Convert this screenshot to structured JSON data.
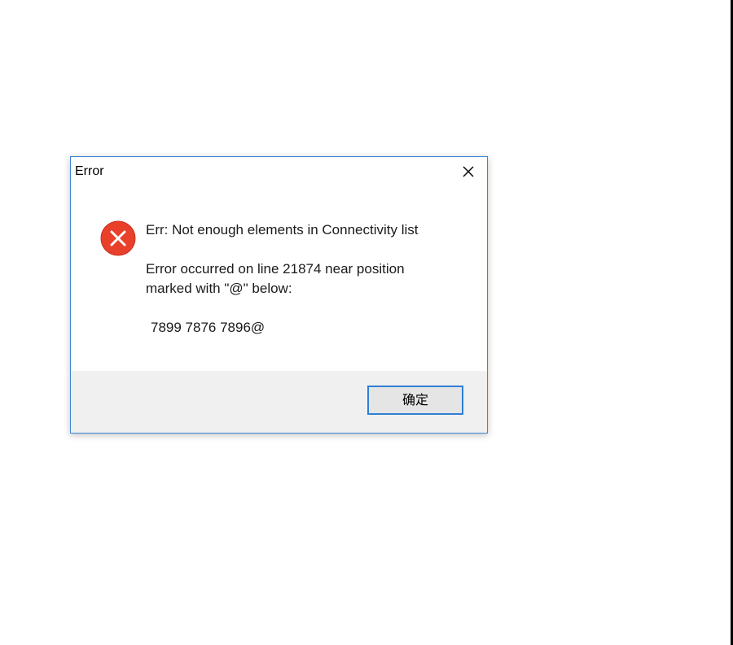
{
  "dialog": {
    "title": "Error",
    "close_icon": "close-icon",
    "icon": "error-x-icon",
    "icon_color": "#e8402b",
    "messages": [
      "Err:  Not enough elements in Connectivity list",
      "Error occurred on line 21874 near position",
      "marked with \"@\" below:",
      "7899 7876 7896@"
    ],
    "ok_label": "确定"
  },
  "colors": {
    "border": "#3c86d4",
    "footer_bg": "#f0f0f0",
    "button_border": "#2f7fd3"
  }
}
